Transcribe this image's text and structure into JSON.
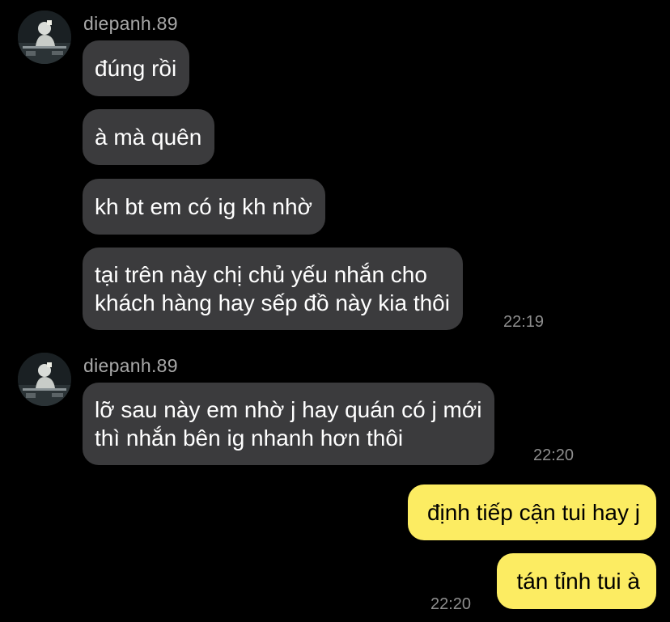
{
  "colors": {
    "background": "#000000",
    "incoming_bubble": "#3b3b3d",
    "outgoing_bubble": "#fcec62",
    "sender_name": "#a8a8a8",
    "timestamp": "#8e8e8e"
  },
  "group1": {
    "sender": "diepanh.89",
    "messages": [
      "đúng rồi",
      "à mà quên",
      "kh bt em có ig kh nhờ",
      "tại trên này chị chủ yếu nhắn cho",
      "khách hàng hay sếp đồ này kia thôi"
    ],
    "time": "22:19"
  },
  "group2": {
    "sender": "diepanh.89",
    "messages": [
      "lỡ sau này em nhờ j hay quán có j mới",
      "thì nhắn bên ig nhanh hơn thôi"
    ],
    "time": "22:20"
  },
  "outgoing": {
    "messages": [
      "định tiếp cận tui hay j",
      "tán tỉnh tui à"
    ],
    "time": "22:20"
  }
}
